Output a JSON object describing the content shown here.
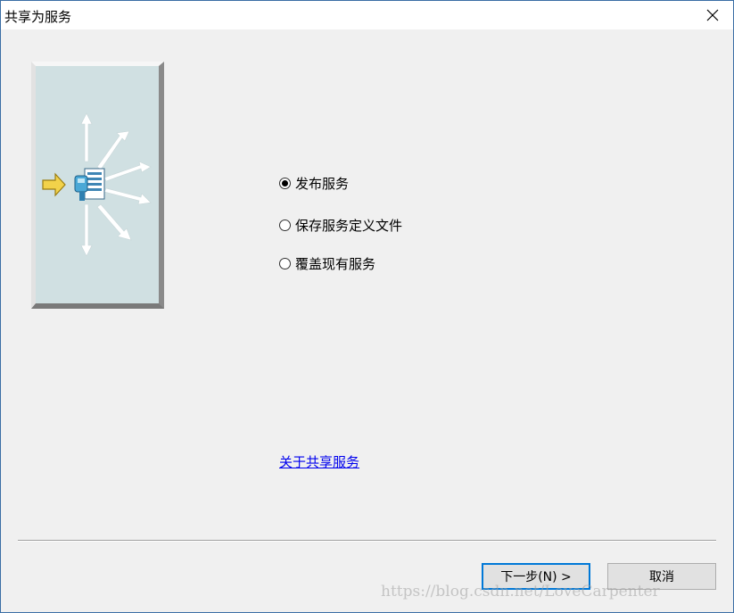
{
  "window": {
    "title": "共享为服务"
  },
  "options": [
    {
      "label": "发布服务",
      "checked": true
    },
    {
      "label": "保存服务定义文件",
      "checked": false
    },
    {
      "label": "覆盖现有服务",
      "checked": false
    }
  ],
  "help_link": "关于共享服务",
  "buttons": {
    "next": "下一步(N) >",
    "cancel": "取消"
  },
  "watermark": "https://blog.csdn.net/LoveCarpenter",
  "icons": {
    "close": "close-icon",
    "banner": "share-service-illustration"
  },
  "colors": {
    "link": "#0000ee",
    "focus_border": "#0078d7",
    "banner_bg": "#d0e0e2",
    "arrow_yellow": "#f2d24a"
  }
}
